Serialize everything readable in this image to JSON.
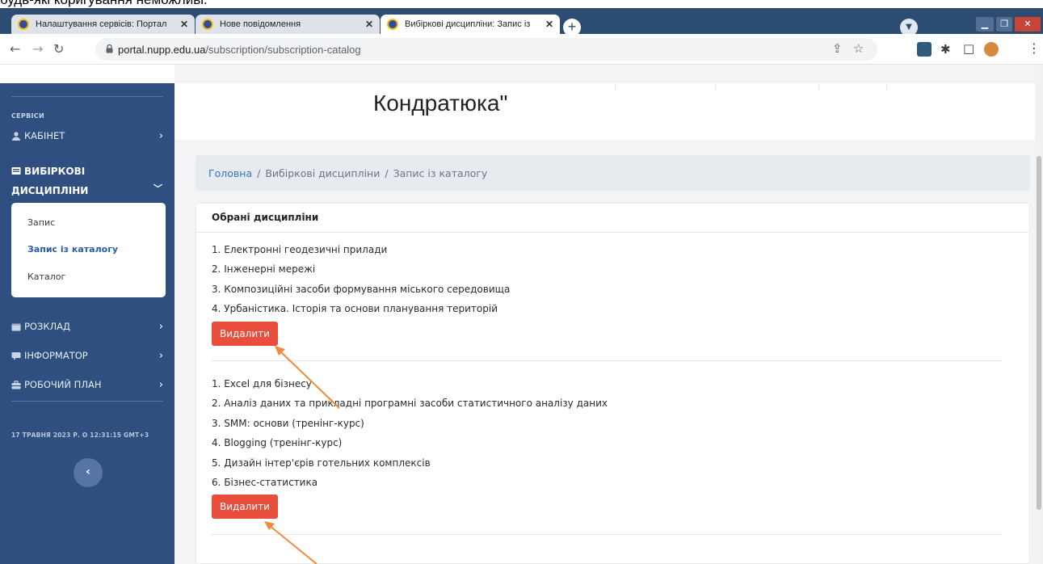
{
  "overlay_caption": "будь-які коригування неможливі.",
  "browser": {
    "tabs": [
      {
        "title": "Налаштування сервісів: Портал",
        "active": false
      },
      {
        "title": "Нове повідомлення",
        "active": false
      },
      {
        "title": "Вибіркові дисципліни: Запис із ",
        "active": true
      }
    ],
    "new_tab": "+",
    "url_host": "portal.nupp.edu.ua",
    "url_path": "/subscription/subscription-catalog"
  },
  "sidebar": {
    "section_heading": "СЕРВІСИ",
    "items": [
      {
        "label": "КАБІНЕТ",
        "icon": "user-icon"
      },
      {
        "label_line1": "ВИБІРКОВІ",
        "label_line2": "ДИСЦИПЛІНИ",
        "icon": "book-icon"
      },
      {
        "label": "РОЗКЛАД",
        "icon": "calendar-icon"
      },
      {
        "label": "ІНФОРМАТОР",
        "icon": "chat-icon"
      },
      {
        "label": "РОБОЧИЙ ПЛАН",
        "icon": "briefcase-icon"
      }
    ],
    "submenu": [
      "Запис",
      "Запис із каталогу",
      "Каталог"
    ],
    "datetime": "17 ТРАВНЯ 2023 Р. О 12:31:15 GMT+3",
    "collapse_symbol": "‹"
  },
  "header": {
    "title": "Кондратюка\""
  },
  "breadcrumb": {
    "items": [
      "Головна",
      "Вибіркові дисципліни",
      "Запис із каталогу"
    ],
    "separator": "/"
  },
  "selected": {
    "title": "Обрані дисципліни",
    "groups": [
      {
        "items": [
          "1. Електронні геодезичні прилади",
          "2. Інженерні мережі",
          "3. Композиційні засоби формування міського середовища",
          "4. Урбаністика. Історія та основи планування територій"
        ],
        "button": "Видалити"
      },
      {
        "items": [
          "1. Excel для бізнесу",
          "2. Аналіз даних та прикладні програмні засоби статистичного аналізу даних",
          "3. SMM: основи (тренінг-курс)",
          "4. Blogging (тренінг-курс)",
          "5. Дизайн інтер'єрів готельних комплексів",
          "6. Бізнес-статистика"
        ],
        "button": "Видалити"
      }
    ]
  },
  "colors": {
    "sidebar": "#2e4f80",
    "tabstrip": "#2b4d74",
    "delete_button": "#e84e3b",
    "arrow": "#f08a3a",
    "link": "#3575c4"
  }
}
